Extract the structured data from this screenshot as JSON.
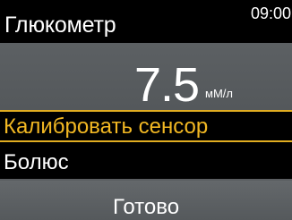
{
  "header": {
    "title": "Глюкометр",
    "time": "09:00"
  },
  "reading": {
    "value": "7.5",
    "unit": "мМ/л"
  },
  "menu": {
    "items": [
      {
        "label": "Калибровать сенсор",
        "selected": true
      },
      {
        "label": "Болюс",
        "selected": false
      }
    ]
  },
  "footer": {
    "button_label": "Готово"
  },
  "colors": {
    "background": "#000000",
    "panel": "#5c6063",
    "highlight": "#f2b823",
    "text": "#ffffff"
  }
}
